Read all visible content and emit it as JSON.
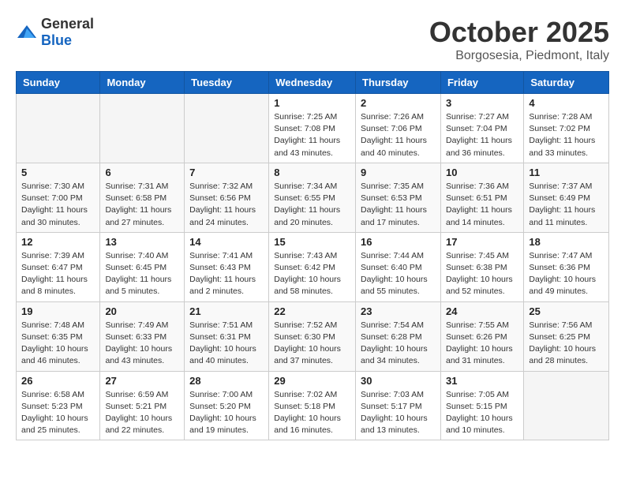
{
  "header": {
    "logo_general": "General",
    "logo_blue": "Blue",
    "month": "October 2025",
    "location": "Borgosesia, Piedmont, Italy"
  },
  "days_of_week": [
    "Sunday",
    "Monday",
    "Tuesday",
    "Wednesday",
    "Thursday",
    "Friday",
    "Saturday"
  ],
  "weeks": [
    [
      {
        "day": "",
        "info": ""
      },
      {
        "day": "",
        "info": ""
      },
      {
        "day": "",
        "info": ""
      },
      {
        "day": "1",
        "info": "Sunrise: 7:25 AM\nSunset: 7:08 PM\nDaylight: 11 hours\nand 43 minutes."
      },
      {
        "day": "2",
        "info": "Sunrise: 7:26 AM\nSunset: 7:06 PM\nDaylight: 11 hours\nand 40 minutes."
      },
      {
        "day": "3",
        "info": "Sunrise: 7:27 AM\nSunset: 7:04 PM\nDaylight: 11 hours\nand 36 minutes."
      },
      {
        "day": "4",
        "info": "Sunrise: 7:28 AM\nSunset: 7:02 PM\nDaylight: 11 hours\nand 33 minutes."
      }
    ],
    [
      {
        "day": "5",
        "info": "Sunrise: 7:30 AM\nSunset: 7:00 PM\nDaylight: 11 hours\nand 30 minutes."
      },
      {
        "day": "6",
        "info": "Sunrise: 7:31 AM\nSunset: 6:58 PM\nDaylight: 11 hours\nand 27 minutes."
      },
      {
        "day": "7",
        "info": "Sunrise: 7:32 AM\nSunset: 6:56 PM\nDaylight: 11 hours\nand 24 minutes."
      },
      {
        "day": "8",
        "info": "Sunrise: 7:34 AM\nSunset: 6:55 PM\nDaylight: 11 hours\nand 20 minutes."
      },
      {
        "day": "9",
        "info": "Sunrise: 7:35 AM\nSunset: 6:53 PM\nDaylight: 11 hours\nand 17 minutes."
      },
      {
        "day": "10",
        "info": "Sunrise: 7:36 AM\nSunset: 6:51 PM\nDaylight: 11 hours\nand 14 minutes."
      },
      {
        "day": "11",
        "info": "Sunrise: 7:37 AM\nSunset: 6:49 PM\nDaylight: 11 hours\nand 11 minutes."
      }
    ],
    [
      {
        "day": "12",
        "info": "Sunrise: 7:39 AM\nSunset: 6:47 PM\nDaylight: 11 hours\nand 8 minutes."
      },
      {
        "day": "13",
        "info": "Sunrise: 7:40 AM\nSunset: 6:45 PM\nDaylight: 11 hours\nand 5 minutes."
      },
      {
        "day": "14",
        "info": "Sunrise: 7:41 AM\nSunset: 6:43 PM\nDaylight: 11 hours\nand 2 minutes."
      },
      {
        "day": "15",
        "info": "Sunrise: 7:43 AM\nSunset: 6:42 PM\nDaylight: 10 hours\nand 58 minutes."
      },
      {
        "day": "16",
        "info": "Sunrise: 7:44 AM\nSunset: 6:40 PM\nDaylight: 10 hours\nand 55 minutes."
      },
      {
        "day": "17",
        "info": "Sunrise: 7:45 AM\nSunset: 6:38 PM\nDaylight: 10 hours\nand 52 minutes."
      },
      {
        "day": "18",
        "info": "Sunrise: 7:47 AM\nSunset: 6:36 PM\nDaylight: 10 hours\nand 49 minutes."
      }
    ],
    [
      {
        "day": "19",
        "info": "Sunrise: 7:48 AM\nSunset: 6:35 PM\nDaylight: 10 hours\nand 46 minutes."
      },
      {
        "day": "20",
        "info": "Sunrise: 7:49 AM\nSunset: 6:33 PM\nDaylight: 10 hours\nand 43 minutes."
      },
      {
        "day": "21",
        "info": "Sunrise: 7:51 AM\nSunset: 6:31 PM\nDaylight: 10 hours\nand 40 minutes."
      },
      {
        "day": "22",
        "info": "Sunrise: 7:52 AM\nSunset: 6:30 PM\nDaylight: 10 hours\nand 37 minutes."
      },
      {
        "day": "23",
        "info": "Sunrise: 7:54 AM\nSunset: 6:28 PM\nDaylight: 10 hours\nand 34 minutes."
      },
      {
        "day": "24",
        "info": "Sunrise: 7:55 AM\nSunset: 6:26 PM\nDaylight: 10 hours\nand 31 minutes."
      },
      {
        "day": "25",
        "info": "Sunrise: 7:56 AM\nSunset: 6:25 PM\nDaylight: 10 hours\nand 28 minutes."
      }
    ],
    [
      {
        "day": "26",
        "info": "Sunrise: 6:58 AM\nSunset: 5:23 PM\nDaylight: 10 hours\nand 25 minutes."
      },
      {
        "day": "27",
        "info": "Sunrise: 6:59 AM\nSunset: 5:21 PM\nDaylight: 10 hours\nand 22 minutes."
      },
      {
        "day": "28",
        "info": "Sunrise: 7:00 AM\nSunset: 5:20 PM\nDaylight: 10 hours\nand 19 minutes."
      },
      {
        "day": "29",
        "info": "Sunrise: 7:02 AM\nSunset: 5:18 PM\nDaylight: 10 hours\nand 16 minutes."
      },
      {
        "day": "30",
        "info": "Sunrise: 7:03 AM\nSunset: 5:17 PM\nDaylight: 10 hours\nand 13 minutes."
      },
      {
        "day": "31",
        "info": "Sunrise: 7:05 AM\nSunset: 5:15 PM\nDaylight: 10 hours\nand 10 minutes."
      },
      {
        "day": "",
        "info": ""
      }
    ]
  ]
}
